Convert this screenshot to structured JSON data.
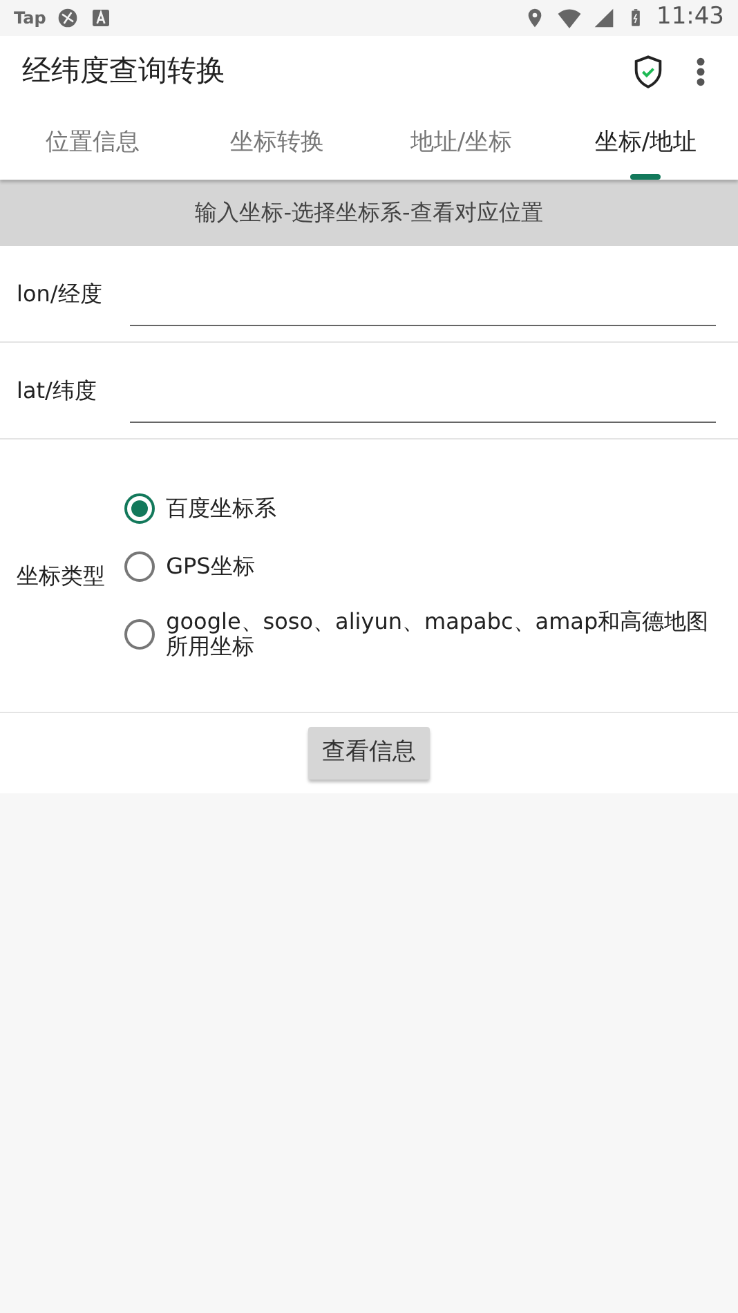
{
  "status_bar": {
    "app_label": "Tap",
    "time": "11:43"
  },
  "app_bar": {
    "title": "经纬度查询转换"
  },
  "tabs": [
    {
      "label": "位置信息",
      "selected": false
    },
    {
      "label": "坐标转换",
      "selected": false
    },
    {
      "label": "地址/坐标",
      "selected": false
    },
    {
      "label": "坐标/地址",
      "selected": true
    }
  ],
  "banner": "输入坐标-选择坐标系-查看对应位置",
  "fields": [
    {
      "label": "lon/经度"
    },
    {
      "label": "lat/纬度"
    }
  ],
  "coordinate_type": {
    "label": "坐标类型",
    "options": [
      {
        "label": "百度坐标系",
        "selected": true
      },
      {
        "label": "GPS坐标",
        "selected": false
      },
      {
        "label": "google、soso、aliyun、mapabc、amap和高德地图所用坐标",
        "selected": false
      }
    ]
  },
  "button": "查看信息"
}
